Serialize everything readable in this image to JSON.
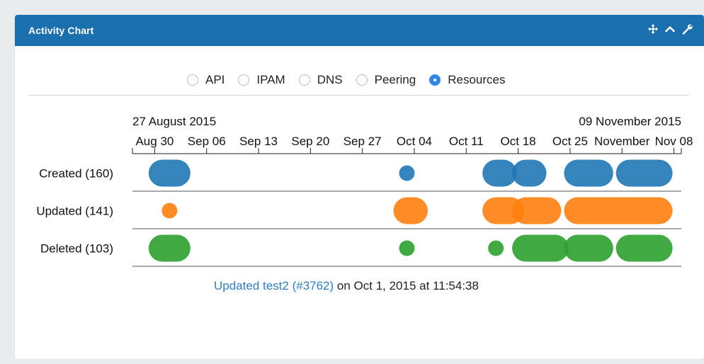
{
  "panel": {
    "title": "Activity Chart",
    "icons": [
      "move-icon",
      "chevron-up-icon",
      "wrench-icon"
    ]
  },
  "radio_options": [
    {
      "label": "API",
      "checked": false
    },
    {
      "label": "IPAM",
      "checked": false
    },
    {
      "label": "DNS",
      "checked": false
    },
    {
      "label": "Peering",
      "checked": false
    },
    {
      "label": "Resources",
      "checked": true
    }
  ],
  "chart_data": {
    "type": "scatter",
    "range_start_label": "27 August 2015",
    "range_end_label": "09 November 2015",
    "tick_labels": [
      "Aug 30",
      "Sep 06",
      "Sep 13",
      "Sep 20",
      "Sep 27",
      "Oct 04",
      "Oct 11",
      "Oct 18",
      "Oct 25",
      "November",
      "Nov 08"
    ],
    "rows": [
      {
        "label": "Created (160)",
        "color": "#1f77b4",
        "clusters": [
          {
            "start": "2015-08-31",
            "end": "2015-09-02"
          },
          {
            "start": "2015-10-03",
            "end": "2015-10-03"
          },
          {
            "start": "2015-10-15",
            "end": "2015-10-16"
          },
          {
            "start": "2015-10-19",
            "end": "2015-10-20"
          },
          {
            "start": "2015-10-26",
            "end": "2015-10-29"
          },
          {
            "start": "2015-11-02",
            "end": "2015-11-06"
          }
        ]
      },
      {
        "label": "Updated (141)",
        "color": "#ff7f0e",
        "clusters": [
          {
            "start": "2015-09-01",
            "end": "2015-09-01"
          },
          {
            "start": "2015-10-03",
            "end": "2015-10-04"
          },
          {
            "start": "2015-10-15",
            "end": "2015-10-17"
          },
          {
            "start": "2015-10-19",
            "end": "2015-10-22"
          },
          {
            "start": "2015-10-26",
            "end": "2015-11-06"
          }
        ]
      },
      {
        "label": "Deleted (103)",
        "color": "#2ca02c",
        "clusters": [
          {
            "start": "2015-08-31",
            "end": "2015-09-02"
          },
          {
            "start": "2015-10-03",
            "end": "2015-10-03"
          },
          {
            "start": "2015-10-15",
            "end": "2015-10-15"
          },
          {
            "start": "2015-10-19",
            "end": "2015-10-23"
          },
          {
            "start": "2015-10-26",
            "end": "2015-10-29"
          },
          {
            "start": "2015-11-02",
            "end": "2015-11-06"
          }
        ]
      }
    ]
  },
  "status": {
    "link_text": "Updated test2 (#3762)",
    "suffix": " on Oct 1, 2015 at 11:54:38"
  }
}
